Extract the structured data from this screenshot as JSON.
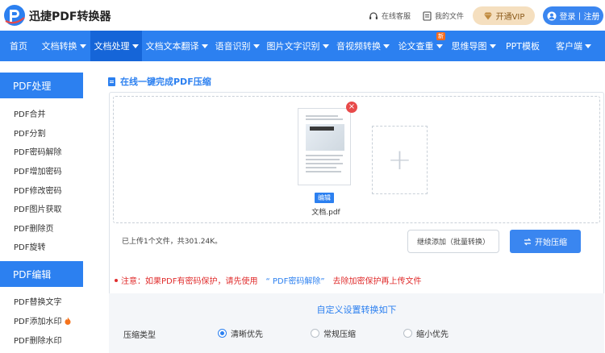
{
  "header": {
    "brand": "迅捷PDF转换器",
    "service_label": "在线客服",
    "my_files_label": "我的文件",
    "vip_label": "开通VIP",
    "login_label": "登录丨注册"
  },
  "nav": {
    "items": [
      {
        "label": "首页",
        "caret": false
      },
      {
        "label": "文档转换",
        "caret": true
      },
      {
        "label": "文档处理",
        "caret": true,
        "active": true
      },
      {
        "label": "文档文本翻译",
        "caret": true
      },
      {
        "label": "语音识别",
        "caret": true
      },
      {
        "label": "图片文字识别",
        "caret": true
      },
      {
        "label": "音视频转换",
        "caret": true
      },
      {
        "label": "论文查重",
        "caret": true,
        "badge": "新"
      },
      {
        "label": "思维导图",
        "caret": true
      },
      {
        "label": "PPT模板",
        "caret": false
      },
      {
        "label": "客户端",
        "caret": true
      }
    ]
  },
  "sidebar": {
    "group1_title": "PDF处理",
    "group1_items": [
      "PDF合并",
      "PDF分割",
      "PDF密码解除",
      "PDF增加密码",
      "PDF修改密码",
      "PDF图片获取",
      "PDF删除页",
      "PDF旋转"
    ],
    "group2_title": "PDF编辑",
    "group2_items": [
      "PDF替换文字",
      "PDF添加水印",
      "PDF删除水印"
    ]
  },
  "main": {
    "section_title": "在线一键完成PDF压缩",
    "file": {
      "edit_label": "编辑",
      "name": "文档.pdf"
    },
    "upload_info": "已上传1个文件，共301.24K。",
    "continue_label": "继续添加（批量转换）",
    "start_label": "开始压缩",
    "notice": {
      "prefix": "注意：如果PDF有密码保护，请先使用",
      "link": "“ PDF密码解除”",
      "suffix": "去除加密保护再上传文件"
    },
    "settings": {
      "title": "自定义设置转换如下",
      "label": "压缩类型",
      "options": [
        {
          "label": "清晰优先",
          "selected": true
        },
        {
          "label": "常规压缩",
          "selected": false
        },
        {
          "label": "缩小优先",
          "selected": false
        }
      ]
    }
  },
  "colors": {
    "primary": "#2c80f0",
    "nav_active": "#1565d8",
    "danger": "#e02d2d",
    "vip_bg": "#f5dfbf"
  }
}
